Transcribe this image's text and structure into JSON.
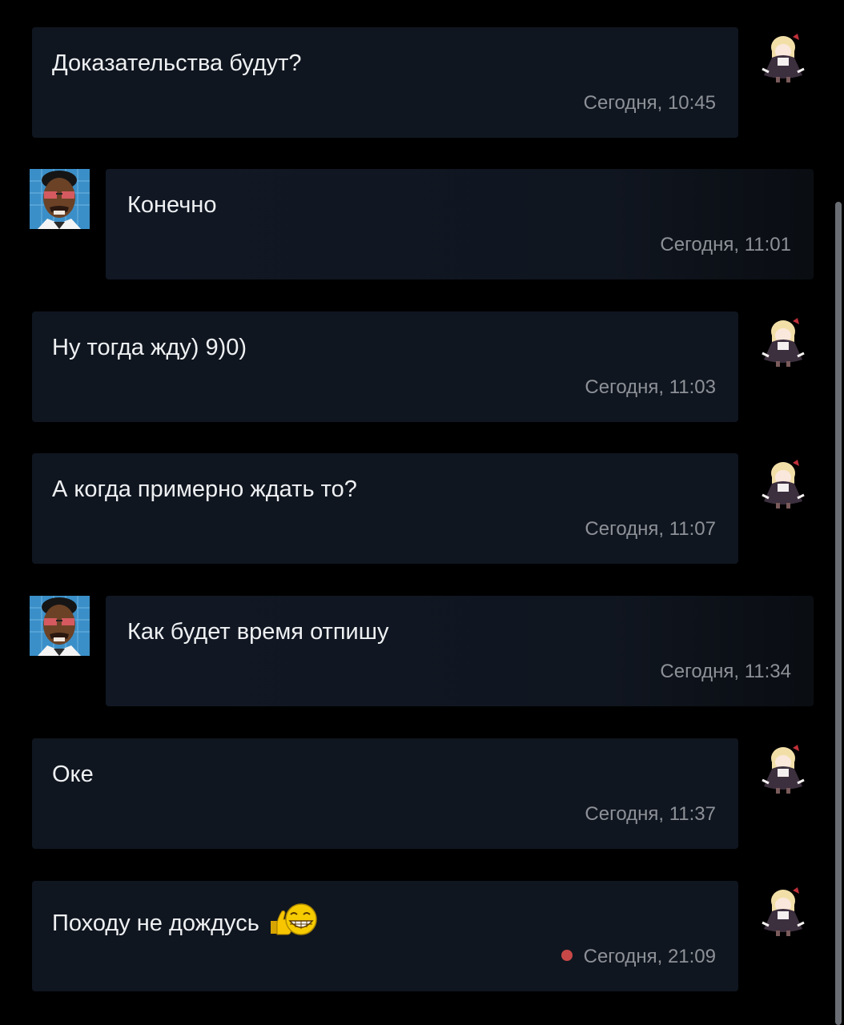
{
  "messages": [
    {
      "author": "me",
      "text": "Доказательства будут?",
      "time": "Сегодня, 10:45"
    },
    {
      "author": "them",
      "text": "Конечно",
      "time": "Сегодня, 11:01"
    },
    {
      "author": "me",
      "text": "Ну тогда жду) 9)0)",
      "time": "Сегодня, 11:03"
    },
    {
      "author": "me",
      "text": "А когда примерно ждать то?",
      "time": "Сегодня, 11:07"
    },
    {
      "author": "them",
      "text": "Как будет время отпишу",
      "time": "Сегодня, 11:34"
    },
    {
      "author": "me",
      "text": "Оке",
      "time": "Сегодня, 11:37"
    },
    {
      "author": "me",
      "text": "Походу не дождусь",
      "time": "Сегодня, 21:09",
      "unread": true,
      "emoji": "thumbs-up-grin-emoji"
    }
  ],
  "colors": {
    "background": "#000000",
    "bubble": "#101620",
    "text": "#eef0f2",
    "time": "#8d9197",
    "unread_dot": "#c84848",
    "scrollbar": "#6a6e74"
  },
  "icons": {
    "my_avatar": "anime-girl-avatar-icon",
    "their_avatar": "man-sunglasses-avatar-icon"
  }
}
